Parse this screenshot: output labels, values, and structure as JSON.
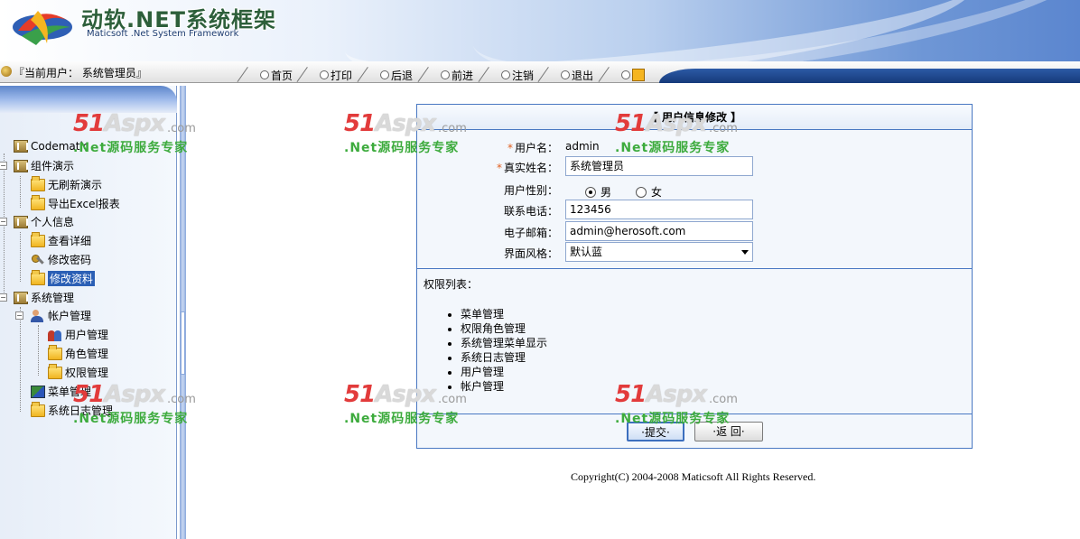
{
  "header": {
    "logo_cn": "动软.NET系统框架",
    "logo_en": "Maticsoft .Net System Framework"
  },
  "toolbar": {
    "current_user_label": "『当前用户：  系统管理员』",
    "nav": [
      "首页",
      "打印",
      "后退",
      "前进",
      "注销",
      "退出"
    ]
  },
  "sidebar": {
    "tree": [
      {
        "label": "Codematic",
        "icon": "book-icon",
        "level": 0
      },
      {
        "label": "组件演示",
        "icon": "book-icon",
        "level": 0
      },
      {
        "label": "无刷新演示",
        "icon": "folder-icon",
        "level": 1
      },
      {
        "label": "导出Excel报表",
        "icon": "folder-icon",
        "level": 1
      },
      {
        "label": "个人信息",
        "icon": "book-icon",
        "level": 0
      },
      {
        "label": "查看详细",
        "icon": "folder-icon",
        "level": 1
      },
      {
        "label": "修改密码",
        "icon": "key-icon",
        "level": 1
      },
      {
        "label": "修改资料",
        "icon": "folder-icon",
        "level": 1,
        "selected": true
      },
      {
        "label": "系统管理",
        "icon": "book-icon",
        "level": 0
      },
      {
        "label": "帐户管理",
        "icon": "user-icon",
        "level": 1
      },
      {
        "label": "用户管理",
        "icon": "users-icon",
        "level": 2
      },
      {
        "label": "角色管理",
        "icon": "folder-icon",
        "level": 2
      },
      {
        "label": "权限管理",
        "icon": "folder-icon",
        "level": 2
      },
      {
        "label": "菜单管理",
        "icon": "menu-icon",
        "level": 1
      },
      {
        "label": "系统日志管理",
        "icon": "folder-icon",
        "level": 1
      }
    ]
  },
  "watermark": {
    "big_51": "51",
    "big_aspx": "Aspx",
    "com": ".com",
    "small": ".Net源码服务专家"
  },
  "form": {
    "title": "【 用户信息修改 】",
    "username_label": "用户名：",
    "username_value": "admin",
    "realname_label": "真实姓名：",
    "realname_value": "系统管理员",
    "gender_label": "用户性别：",
    "gender_male": "男",
    "gender_female": "女",
    "gender_selected": "男",
    "phone_label": "联系电话：",
    "phone_value": "123456",
    "email_label": "电子邮箱：",
    "email_value": "admin@herosoft.com",
    "style_label": "界面风格：",
    "style_value": "默认蓝",
    "required_mark": "*",
    "permissions_title": "权限列表：",
    "permissions": [
      "菜单管理",
      "权限角色管理",
      "系统管理菜单显示",
      "系统日志管理",
      "用户管理",
      "帐户管理"
    ],
    "submit_label": "·提交·",
    "back_label": "·返 回·"
  },
  "footer": {
    "copyright": "Copyright(C) 2004-2008 Maticsoft All Rights Reserved."
  },
  "colors": {
    "accent_blue": "#4978c2",
    "selected_bg": "#2b5fb5",
    "watermark_red": "#e23b3b",
    "watermark_green": "#3dab3d"
  }
}
